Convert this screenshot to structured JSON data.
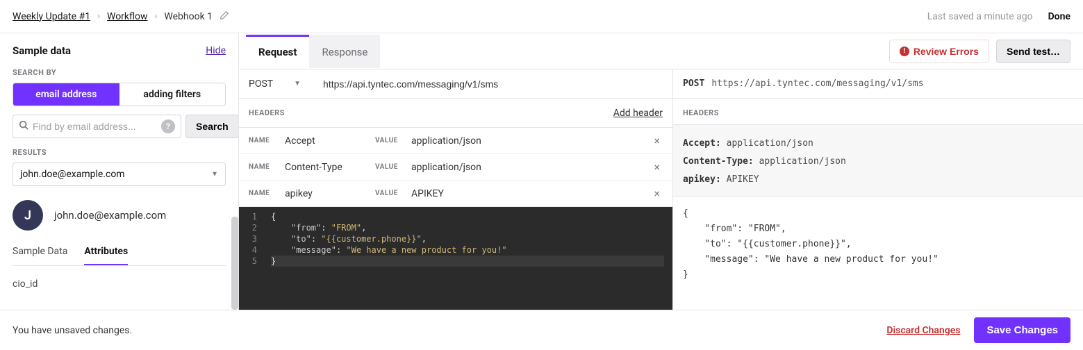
{
  "breadcrumb": {
    "item0": "Weekly Update #1",
    "item1": "Workflow",
    "item2": "Webhook 1"
  },
  "top": {
    "saved": "Last saved a minute ago",
    "done": "Done"
  },
  "left": {
    "title": "Sample data",
    "hide": "Hide",
    "search_by_label": "SEARCH BY",
    "toggle": {
      "email": "email address",
      "filters": "adding filters"
    },
    "search_placeholder": "Find by email address...",
    "search_btn": "Search",
    "results_label": "RESULTS",
    "results_selected": "john.doe@example.com",
    "user_initial": "J",
    "user_email": "john.doe@example.com",
    "tab_sample": "Sample Data",
    "tab_attrs": "Attributes",
    "attr0": "cio_id"
  },
  "tabs": {
    "request": "Request",
    "response": "Response"
  },
  "buttons": {
    "errors": "Review Errors",
    "test": "Send test…",
    "discard": "Discard Changes",
    "save": "Save Changes"
  },
  "request": {
    "method": "POST",
    "url": "https://api.tyntec.com/messaging/v1/sms",
    "headers_label": "HEADERS",
    "add_header": "Add header",
    "name_lbl": "NAME",
    "value_lbl": "VALUE",
    "headers": [
      {
        "name": "Accept",
        "value": "application/json"
      },
      {
        "name": "Content-Type",
        "value": "application/json"
      },
      {
        "name": "apikey",
        "value": "APIKEY"
      }
    ],
    "body": {
      "line1": "{",
      "line2_key": "\"from\"",
      "line2_val": "\"FROM\"",
      "line3_key": "\"to\"",
      "line3_val": "\"{{customer.phone}}\"",
      "line4_key": "\"message\"",
      "line4_val": "\"We have a new product for you!\"",
      "line5": "}"
    }
  },
  "response": {
    "method": "POST",
    "url": "https://api.tyntec.com/messaging/v1/sms",
    "headers_label": "HEADERS",
    "headers": [
      {
        "k": "Accept:",
        "v": "application/json"
      },
      {
        "k": "Content-Type:",
        "v": "application/json"
      },
      {
        "k": "apikey:",
        "v": "APIKEY"
      }
    ],
    "body_l1": "{",
    "body_l2": "    \"from\": \"FROM\",",
    "body_l3": "    \"to\": \"{{customer.phone}}\",",
    "body_l4": "    \"message\": \"We have a new product for you!\"",
    "body_l5": "}"
  },
  "bottom": {
    "unsaved": "You have unsaved changes."
  }
}
